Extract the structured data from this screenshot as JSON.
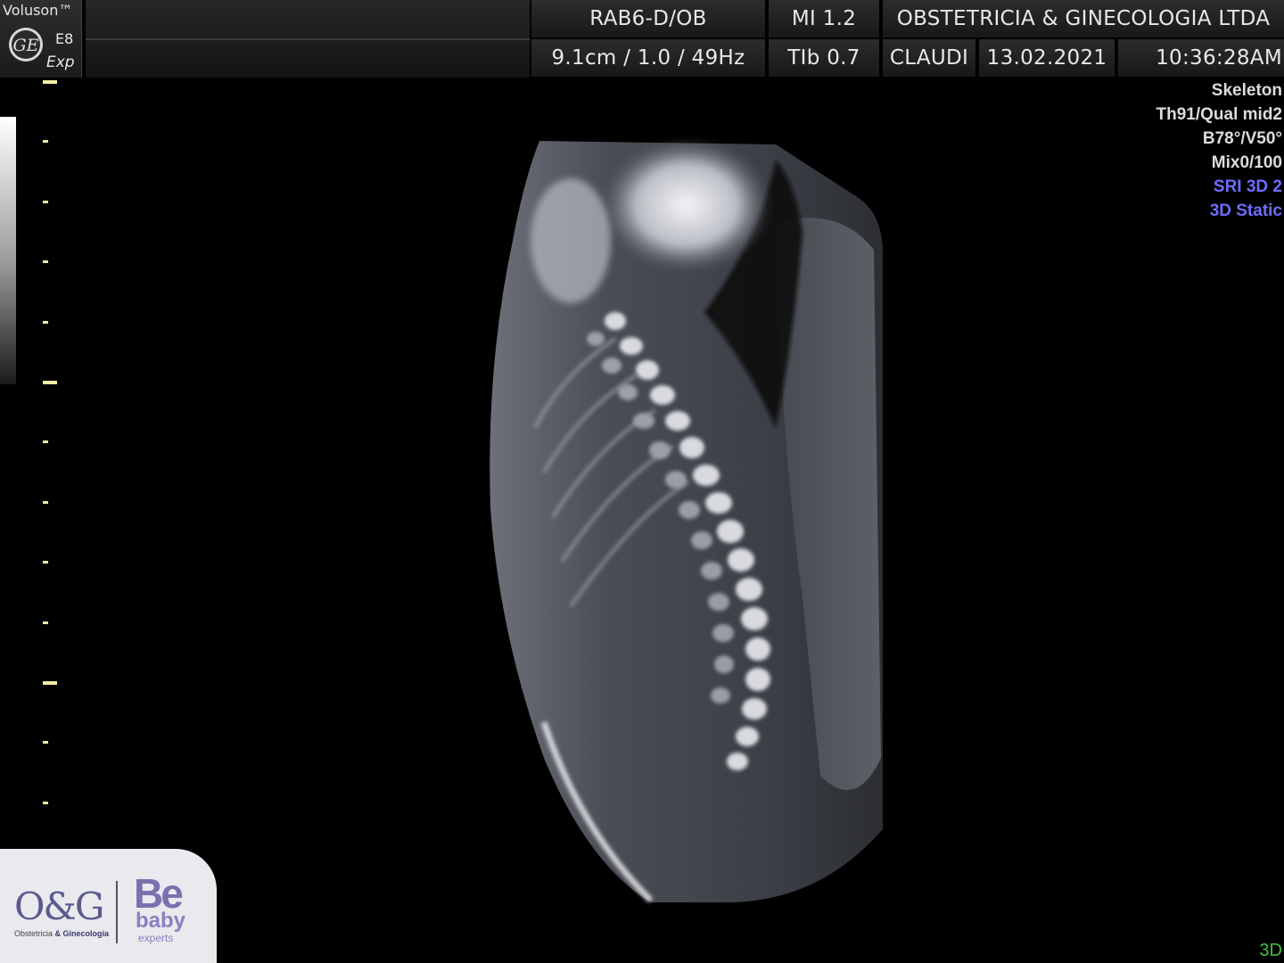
{
  "brand": {
    "name": "Voluson™",
    "model": "E8",
    "variant": "Exp",
    "logo_icon": "ge-monogram-icon"
  },
  "header": {
    "probe_preset": "RAB6-D/OB",
    "mechanical_index": "MI  1.2",
    "institution": "OBSTETRICIA & GINECOLOGIA LTDA",
    "depth_gain_freq": "9.1cm / 1.0 / 49Hz",
    "thermal_index": "TIb  0.7",
    "operator": "CLAUDI",
    "date": "13.02.2021",
    "time": "10:36:28AM"
  },
  "info_panel": {
    "render_mode": "Skeleton",
    "threshold_quality": "Th91/Qual mid2",
    "angles": "B78°/V50°",
    "mix": "Mix0/100",
    "sri": "SRI 3D 2",
    "acquisition": "3D Static"
  },
  "mode_indicator": "3D",
  "colors": {
    "ruler_tick": "#f3eca6",
    "info_highlight": "#6d6dff",
    "mode_indicator": "#3fbf3f"
  },
  "clinic_logo": {
    "og_mark": "O&G",
    "og_caption_plain": "Obstetricia ",
    "og_caption_bold": "& Ginecología",
    "be_mark": "Be",
    "be_baby": "baby",
    "be_experts": "experts"
  }
}
